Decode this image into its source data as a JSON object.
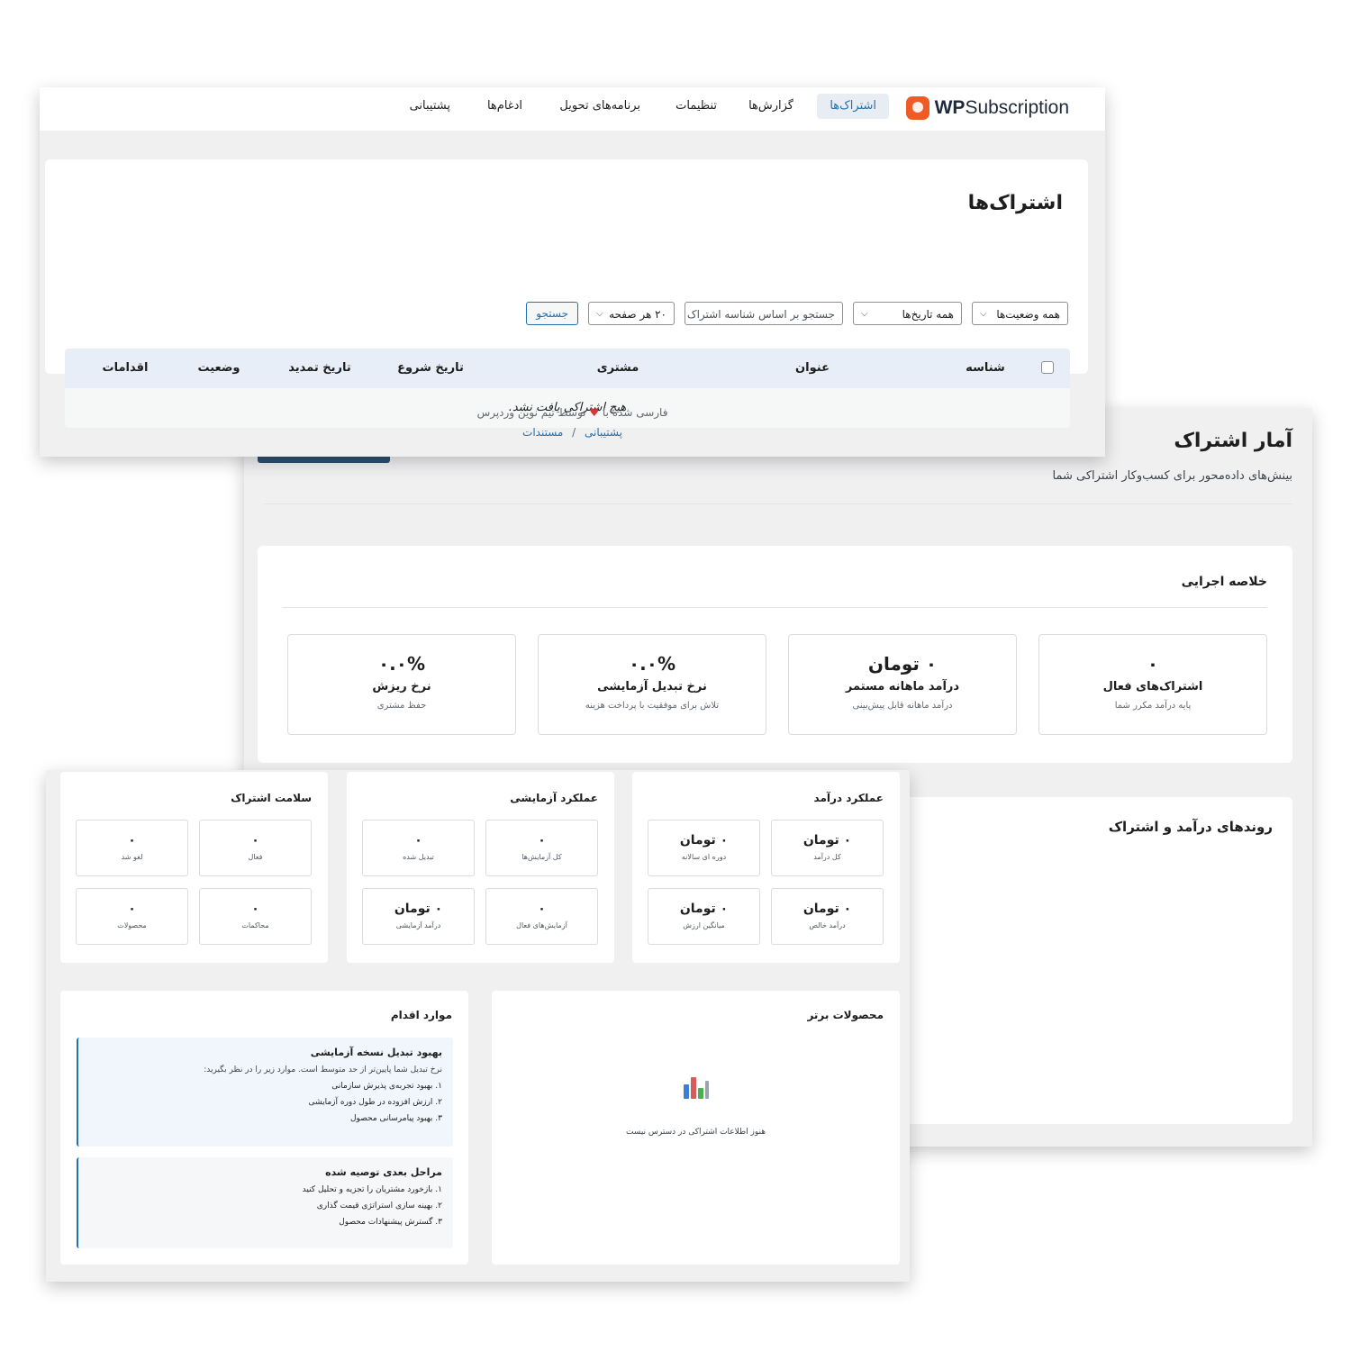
{
  "nav": {
    "brand_wp": "WP",
    "brand_rest": "Subscription",
    "items": [
      "اشتراک‌ها",
      "گزارش‌ها",
      "تنظیمات",
      "برنامه‌های تحویل",
      "ادغام‌ها",
      "پشتیبانی"
    ]
  },
  "subscriptions": {
    "title": "اشتراک‌ها",
    "filters": {
      "status": "همه وضعیت‌ها",
      "dates": "همه تاریخ‌ها",
      "search_placeholder": "جستجو بر اساس شناسه اشتراک",
      "per_page": "۲۰ هر صفحه",
      "search_button": "جستجو"
    },
    "columns": [
      "شناسه",
      "عنوان",
      "مشتری",
      "تاریخ شروع",
      "تاریخ تمدید",
      "وضعیت",
      "اقدامات"
    ],
    "empty": "هیچ اشتراکی یافت نشد."
  },
  "footer": {
    "credit_before": "فارسی شده با",
    "credit_after": "توسط تیم نوین وردپرس",
    "support": "پشتیبانی",
    "sep": "/",
    "docs": "مستندات"
  },
  "stats": {
    "title": "آمار اشتراک",
    "subtitle": "بینش‌های داده‌محور برای کسب‌وکار اشتراکی شما",
    "exec_title": "خلاصه اجرایی",
    "kpis": [
      {
        "value": "۰",
        "label": "اشتراک‌های فعال",
        "sub": "پایه درآمد مکرر شما"
      },
      {
        "value": "۰ تومان",
        "label": "درآمد ماهانه مستمر",
        "sub": "درآمد ماهانه قابل پیش‌بینی"
      },
      {
        "value": "۰.۰%",
        "label": "نرخ تبدیل آزمایشی",
        "sub": "تلاش برای موفقیت با پرداخت هزینه"
      },
      {
        "value": "۰.۰%",
        "label": "نرخ ریزش",
        "sub": "حفظ مشتری"
      }
    ],
    "trends_title": "روندهای درآمد و اشتراک"
  },
  "panels": {
    "revenue": {
      "title": "عملکرد درآمد",
      "cells": [
        {
          "value": "۰ تومان",
          "label": "کل درآمد"
        },
        {
          "value": "۰ تومان",
          "label": "دوره ای سالانه"
        },
        {
          "value": "۰ تومان",
          "label": "درآمد خالص"
        },
        {
          "value": "۰ تومان",
          "label": "میانگین ارزش"
        }
      ]
    },
    "trial": {
      "title": "عملکرد آزمایشی",
      "cells": [
        {
          "value": "۰",
          "label": "کل آزمایش‌ها"
        },
        {
          "value": "۰",
          "label": "تبدیل شده"
        },
        {
          "value": "۰",
          "label": "آزمایش‌های فعال"
        },
        {
          "value": "۰ تومان",
          "label": "درآمد آزمایشی"
        }
      ]
    },
    "health": {
      "title": "سلامت اشتراک",
      "cells": [
        {
          "value": "۰",
          "label": "فعال"
        },
        {
          "value": "۰",
          "label": "لغو شد"
        },
        {
          "value": "۰",
          "label": "محاکمات"
        },
        {
          "value": "۰",
          "label": "محصولات"
        }
      ]
    },
    "products": {
      "title": "محصولات برتر",
      "empty": "هنوز اطلاعات اشتراکی در دسترس نیست"
    },
    "actions": {
      "title": "موارد اقدام",
      "box1": {
        "title": "بهبود تبدیل نسخه آزمایشی",
        "desc": "نرخ تبدیل شما پایین‌تر از حد متوسط است. موارد زیر را در نظر بگیرید:",
        "items": [
          "۱. بهبود تجربه‌ی پذیرش سازمانی",
          "۲. ارزش افزوده در طول دوره آزمایشی",
          "۳. بهبود پیامرسانی محصول"
        ]
      },
      "box2": {
        "title": "مراحل بعدی توصیه شده",
        "items": [
          "۱. بازخورد مشتریان را تجزیه و تحلیل کنید",
          "۲. بهینه سازی استراتژی قیمت گذاری",
          "۳. گسترش پیشنهادات محصول"
        ]
      }
    }
  }
}
